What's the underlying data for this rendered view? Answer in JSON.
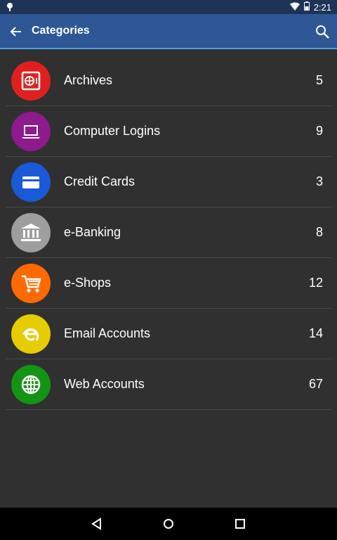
{
  "status_bar": {
    "time": "2:21"
  },
  "app_bar": {
    "title": "Categories",
    "back_icon": "arrow-back-icon",
    "search_icon": "search-icon"
  },
  "categories": [
    {
      "label": "Archives",
      "count": "5",
      "icon": "safe-icon",
      "color": "#e02020"
    },
    {
      "label": "Computer Logins",
      "count": "9",
      "icon": "laptop-icon",
      "color": "#8e1a8e"
    },
    {
      "label": "Credit Cards",
      "count": "3",
      "icon": "credit-card-icon",
      "color": "#1a5ad8"
    },
    {
      "label": "e-Banking",
      "count": "8",
      "icon": "bank-icon",
      "color": "#9e9e9e"
    },
    {
      "label": "e-Shops",
      "count": "12",
      "icon": "shopping-cart-icon",
      "color": "#ff6a00"
    },
    {
      "label": "Email Accounts",
      "count": "14",
      "icon": "email-e-icon",
      "color": "#e6cc00"
    },
    {
      "label": "Web Accounts",
      "count": "67",
      "icon": "globe-icon",
      "color": "#149414"
    }
  ],
  "colors": {
    "app_bar": "#2f5795",
    "status_bar": "#1e3356",
    "background": "#303030",
    "accent_line": "#4fa3e0"
  }
}
